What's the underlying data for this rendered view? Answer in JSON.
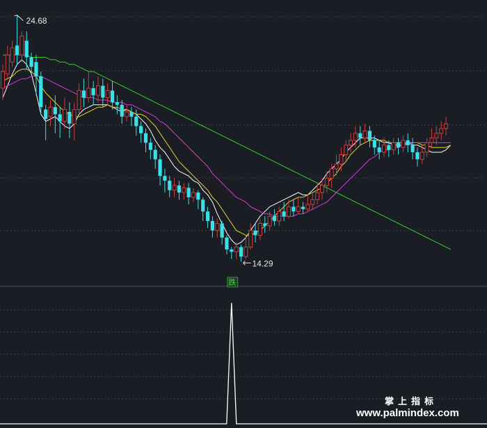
{
  "chart_data": {
    "type": "candlestick",
    "x_count": 104,
    "price_range": [
      13.6,
      25.2
    ],
    "colors": {
      "background": "#1b1d24",
      "grid": "#3a3f4a",
      "up": "#d23c3c",
      "down": "#38e0e8",
      "ma_short": "#ffffff",
      "ma_mid": "#e8d42c",
      "ma_long": "#d63ad6",
      "ma_longest": "#3ac83a",
      "indicator": "#ffffff",
      "signal": "#3ddc4a"
    },
    "annotations": {
      "high_label": "24.68",
      "high_value": 24.68,
      "high_index": 3,
      "low_label": "14.29",
      "low_value": 14.29,
      "low_index": 50
    },
    "signal": {
      "label": "跌",
      "index": 48
    },
    "series": [
      {
        "name": "",
        "color_key": "ma_short",
        "values": [
          21.2,
          21.7,
          22.2,
          22.6,
          22.8,
          22.6,
          22.2,
          21.4,
          20.5,
          20.2,
          20.3,
          20.4,
          20.2,
          20.0,
          19.9,
          20.1,
          20.5,
          20.7,
          20.8,
          20.9,
          20.9,
          20.9,
          20.9,
          20.8,
          20.7,
          20.6,
          20.7,
          20.6,
          20.5,
          20.3,
          20.1,
          19.8,
          19.4,
          19.1,
          18.9,
          18.6,
          18.3,
          18.1,
          18.0,
          17.9,
          17.7,
          17.6,
          17.3,
          17.1,
          16.8,
          16.3,
          15.9,
          15.5,
          15.2,
          15.0,
          15.1,
          15.3,
          15.6,
          15.9,
          16.2,
          16.4,
          16.6,
          16.7,
          16.8,
          16.9,
          17.0,
          17.1,
          17.2,
          17.1,
          17.1,
          17.3,
          17.5,
          17.7,
          18.0,
          18.2,
          18.4,
          18.6,
          18.9,
          19.1,
          19.3,
          19.5,
          19.5,
          19.5,
          19.5,
          19.4,
          19.3,
          19.3,
          19.2,
          19.2,
          19.2,
          19.3,
          19.2,
          19.2,
          19.1,
          19.0,
          18.9,
          18.9,
          18.9,
          19.0,
          19.2
        ]
      },
      {
        "name": "",
        "color_key": "ma_mid",
        "values": [
          21.9,
          22.0,
          22.1,
          22.3,
          22.4,
          22.4,
          22.3,
          22.1,
          21.7,
          21.4,
          21.2,
          21.0,
          20.8,
          20.6,
          20.5,
          20.4,
          20.4,
          20.5,
          20.6,
          20.7,
          20.8,
          20.8,
          20.9,
          20.8,
          20.8,
          20.7,
          20.7,
          20.6,
          20.5,
          20.5,
          20.4,
          20.2,
          20.0,
          19.7,
          19.4,
          19.1,
          18.8,
          18.5,
          18.3,
          18.1,
          17.9,
          17.7,
          17.5,
          17.3,
          17.0,
          16.8,
          16.5,
          16.2,
          15.9,
          15.6,
          15.5,
          15.4,
          15.4,
          15.5,
          15.6,
          15.8,
          16.0,
          16.2,
          16.4,
          16.6,
          16.8,
          16.9,
          17.0,
          17.0,
          17.1,
          17.2,
          17.3,
          17.4,
          17.6,
          17.8,
          18.0,
          18.3,
          18.5,
          18.8,
          19.0,
          19.2,
          19.3,
          19.4,
          19.4,
          19.4,
          19.4,
          19.3,
          19.3,
          19.3,
          19.3,
          19.3,
          19.3,
          19.3,
          19.2,
          19.2,
          19.1,
          19.1,
          19.1,
          19.1,
          19.2
        ]
      },
      {
        "name": "",
        "color_key": "ma_long",
        "values": [
          21.6,
          21.7,
          21.8,
          21.9,
          22.0,
          22.0,
          22.1,
          22.1,
          22.1,
          22.0,
          21.9,
          21.8,
          21.7,
          21.6,
          21.5,
          21.4,
          21.3,
          21.2,
          21.2,
          21.2,
          21.1,
          21.1,
          21.1,
          21.0,
          21.0,
          21.0,
          20.9,
          20.9,
          20.8,
          20.7,
          20.6,
          20.5,
          20.4,
          20.2,
          20.1,
          19.9,
          19.7,
          19.5,
          19.3,
          19.1,
          18.9,
          18.7,
          18.5,
          18.3,
          18.0,
          17.8,
          17.6,
          17.4,
          17.2,
          17.0,
          16.9,
          16.8,
          16.6,
          16.5,
          16.4,
          16.3,
          16.3,
          16.2,
          16.2,
          16.2,
          16.2,
          16.2,
          16.3,
          16.3,
          16.4,
          16.5,
          16.6,
          16.7,
          16.8,
          17.0,
          17.2,
          17.4,
          17.6,
          17.8,
          18.0,
          18.2,
          18.4,
          18.6,
          18.7,
          18.9,
          19.0,
          19.0,
          19.1,
          19.1,
          19.2,
          19.2,
          19.3,
          19.3,
          19.3,
          19.3,
          19.3,
          19.3,
          19.3,
          19.3,
          19.3
        ]
      },
      {
        "name": "",
        "color_key": "ma_longest",
        "values": [
          23.0,
          23.0,
          23.0,
          23.0,
          23.0,
          23.0,
          22.9,
          22.9,
          22.9,
          22.9,
          22.8,
          22.8,
          22.7,
          22.7,
          22.6,
          22.6,
          22.5,
          22.4,
          22.3,
          22.3,
          22.2,
          22.1,
          22.0,
          21.9,
          21.8,
          21.7,
          21.6,
          21.5,
          21.4,
          21.3,
          21.2,
          21.1,
          21.0,
          20.9,
          20.8,
          20.7,
          20.6,
          20.5,
          20.4,
          20.3,
          20.2,
          20.1,
          20.0,
          19.9,
          19.8,
          19.7,
          19.6,
          19.5,
          19.4,
          19.3,
          19.2,
          19.1,
          19.0,
          18.9,
          18.8,
          18.7,
          18.6,
          18.5,
          18.4,
          18.3,
          18.2,
          18.1,
          18.0,
          17.9,
          17.8,
          17.7,
          17.6,
          17.5,
          17.4,
          17.3,
          17.2,
          17.1,
          17.0,
          16.9,
          16.8,
          16.7,
          16.6,
          16.5,
          16.4,
          16.3,
          16.2,
          16.1,
          16.0,
          15.9,
          15.8,
          15.7,
          15.6,
          15.5,
          15.4,
          15.3,
          15.2,
          15.1,
          15.0,
          14.9,
          14.8
        ]
      }
    ],
    "candles": [
      [
        21.6,
        22.3,
        21.1,
        22.6
      ],
      [
        22.2,
        23.0,
        22.0,
        23.4
      ],
      [
        22.7,
        23.3,
        22.5,
        23.6
      ],
      [
        23.4,
        23.0,
        22.6,
        24.68
      ],
      [
        23.0,
        23.8,
        22.7,
        24.0
      ],
      [
        23.6,
        22.9,
        22.4,
        24.0
      ],
      [
        22.9,
        22.5,
        22.2,
        23.1
      ],
      [
        22.7,
        22.1,
        21.3,
        23.0
      ],
      [
        22.1,
        20.8,
        20.5,
        22.3
      ],
      [
        20.7,
        20.3,
        19.4,
        20.9
      ],
      [
        20.4,
        20.8,
        20.0,
        21.1
      ],
      [
        20.8,
        20.5,
        19.7,
        21.3
      ],
      [
        20.5,
        20.2,
        19.5,
        20.8
      ],
      [
        20.2,
        20.7,
        19.9,
        21.2
      ],
      [
        20.6,
        20.1,
        19.5,
        21.0
      ],
      [
        20.1,
        20.7,
        19.4,
        21.0
      ],
      [
        20.7,
        21.5,
        20.5,
        21.8
      ],
      [
        21.5,
        21.2,
        20.8,
        22.0
      ],
      [
        21.2,
        21.6,
        21.0,
        22.3
      ],
      [
        21.6,
        21.3,
        20.9,
        21.9
      ],
      [
        21.3,
        21.7,
        21.0,
        22.1
      ],
      [
        21.7,
        21.2,
        20.8,
        22.0
      ],
      [
        21.2,
        21.5,
        20.9,
        21.8
      ],
      [
        21.5,
        21.0,
        20.7,
        21.9
      ],
      [
        21.0,
        20.9,
        20.5,
        21.3
      ],
      [
        20.9,
        20.4,
        20.1,
        21.1
      ],
      [
        20.4,
        20.6,
        20.2,
        20.9
      ],
      [
        20.6,
        20.4,
        20.0,
        20.8
      ],
      [
        20.4,
        20.0,
        19.6,
        20.7
      ],
      [
        20.0,
        19.7,
        19.3,
        20.2
      ],
      [
        19.7,
        19.3,
        18.9,
        19.9
      ],
      [
        19.3,
        19.0,
        18.6,
        19.5
      ],
      [
        19.0,
        18.6,
        18.2,
        19.2
      ],
      [
        18.6,
        17.9,
        17.5,
        18.8
      ],
      [
        17.9,
        17.7,
        17.2,
        18.2
      ],
      [
        17.7,
        17.3,
        17.0,
        17.9
      ],
      [
        17.3,
        17.5,
        17.0,
        17.8
      ],
      [
        17.5,
        17.2,
        16.9,
        17.7
      ],
      [
        17.2,
        17.4,
        16.9,
        17.6
      ],
      [
        17.4,
        17.0,
        16.7,
        17.6
      ],
      [
        17.0,
        17.2,
        16.8,
        17.4
      ],
      [
        17.2,
        16.9,
        16.5,
        17.3
      ],
      [
        16.9,
        16.4,
        16.0,
        17.0
      ],
      [
        16.4,
        16.0,
        15.7,
        16.6
      ],
      [
        16.0,
        15.6,
        15.3,
        16.2
      ],
      [
        15.6,
        15.9,
        15.3,
        16.1
      ],
      [
        15.9,
        15.3,
        15.0,
        16.0
      ],
      [
        15.3,
        14.8,
        14.6,
        15.4
      ],
      [
        14.8,
        14.7,
        14.4,
        14.9
      ],
      [
        14.7,
        14.9,
        14.4,
        15.1
      ],
      [
        14.9,
        14.5,
        14.29,
        15.0
      ],
      [
        14.5,
        14.9,
        14.4,
        15.4
      ],
      [
        14.9,
        15.6,
        14.8,
        15.9
      ],
      [
        15.6,
        15.4,
        15.1,
        15.9
      ],
      [
        15.4,
        15.9,
        15.2,
        16.1
      ],
      [
        15.9,
        15.8,
        15.5,
        16.2
      ],
      [
        15.8,
        16.2,
        15.6,
        16.4
      ],
      [
        16.2,
        16.0,
        15.8,
        16.5
      ],
      [
        16.0,
        16.4,
        15.8,
        16.6
      ],
      [
        16.4,
        16.2,
        16.0,
        16.8
      ],
      [
        16.2,
        16.6,
        16.1,
        16.9
      ],
      [
        16.6,
        16.4,
        16.2,
        16.9
      ],
      [
        16.4,
        16.6,
        16.3,
        17.0
      ],
      [
        16.6,
        16.5,
        16.3,
        16.8
      ],
      [
        16.5,
        16.7,
        16.4,
        17.1
      ],
      [
        16.7,
        16.9,
        16.5,
        17.2
      ],
      [
        16.9,
        17.2,
        16.7,
        17.6
      ],
      [
        17.2,
        17.5,
        16.9,
        17.8
      ],
      [
        17.5,
        17.8,
        17.2,
        18.1
      ],
      [
        17.8,
        18.2,
        17.4,
        18.4
      ],
      [
        18.2,
        18.4,
        17.9,
        18.8
      ],
      [
        18.4,
        18.8,
        18.1,
        19.1
      ],
      [
        18.8,
        19.2,
        18.5,
        19.4
      ],
      [
        19.2,
        19.4,
        18.9,
        19.7
      ],
      [
        19.4,
        19.7,
        19.1,
        20.0
      ],
      [
        19.7,
        19.5,
        19.2,
        20.0
      ],
      [
        19.5,
        19.8,
        19.3,
        20.1
      ],
      [
        19.8,
        19.4,
        19.1,
        20.0
      ],
      [
        19.4,
        19.1,
        18.8,
        19.6
      ],
      [
        19.1,
        18.9,
        18.6,
        19.4
      ],
      [
        18.9,
        19.2,
        18.7,
        19.5
      ],
      [
        19.2,
        19.0,
        18.7,
        19.4
      ],
      [
        19.0,
        19.3,
        18.8,
        19.5
      ],
      [
        19.3,
        19.1,
        18.8,
        19.5
      ],
      [
        19.1,
        19.4,
        18.9,
        19.6
      ],
      [
        19.4,
        19.2,
        18.9,
        19.7
      ],
      [
        19.2,
        18.9,
        18.6,
        19.5
      ],
      [
        18.9,
        18.6,
        18.3,
        19.1
      ],
      [
        18.6,
        18.9,
        18.4,
        19.2
      ],
      [
        18.9,
        19.3,
        18.7,
        19.5
      ],
      [
        19.3,
        19.5,
        19.1,
        19.9
      ],
      [
        19.5,
        19.7,
        19.2,
        20.0
      ],
      [
        19.7,
        19.9,
        19.4,
        20.2
      ],
      [
        19.9,
        20.1,
        19.6,
        20.4
      ]
    ],
    "indicator": {
      "spike_index": 48,
      "spike_value": 1,
      "range": [
        0,
        1
      ]
    }
  },
  "watermark": {
    "cn": "掌上指标",
    "url": "www.palmindex.com"
  }
}
